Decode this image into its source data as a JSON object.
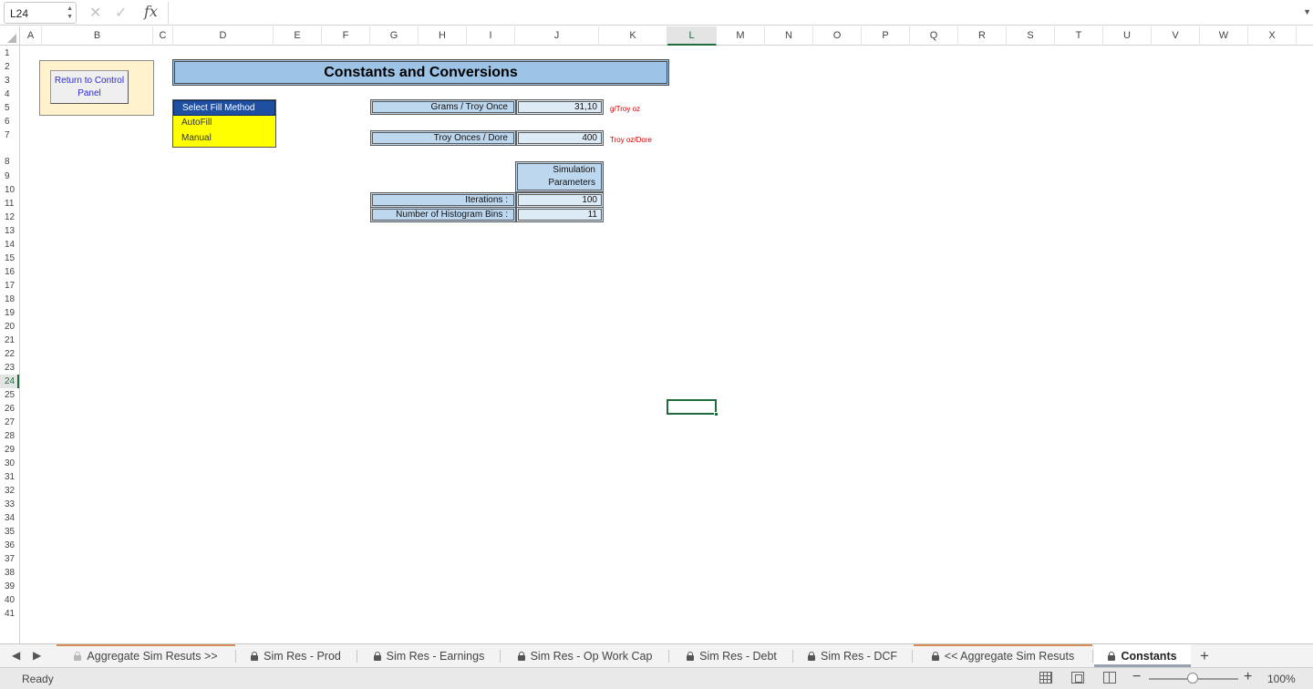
{
  "formula_bar": {
    "name_box": "L24",
    "cancel_icon": "✕",
    "enter_icon": "✓",
    "fx_label": "fx",
    "formula": ""
  },
  "columns": [
    {
      "label": "A",
      "selected": false
    },
    {
      "label": "B",
      "selected": false
    },
    {
      "label": "C",
      "selected": false
    },
    {
      "label": "D",
      "selected": false
    },
    {
      "label": "E",
      "selected": false
    },
    {
      "label": "F",
      "selected": false
    },
    {
      "label": "G",
      "selected": false
    },
    {
      "label": "H",
      "selected": false
    },
    {
      "label": "I",
      "selected": false
    },
    {
      "label": "J",
      "selected": false
    },
    {
      "label": "K",
      "selected": false
    },
    {
      "label": "L",
      "selected": true
    },
    {
      "label": "M",
      "selected": false
    },
    {
      "label": "N",
      "selected": false
    },
    {
      "label": "O",
      "selected": false
    },
    {
      "label": "P",
      "selected": false
    },
    {
      "label": "Q",
      "selected": false
    },
    {
      "label": "R",
      "selected": false
    },
    {
      "label": "S",
      "selected": false
    },
    {
      "label": "T",
      "selected": false
    },
    {
      "label": "U",
      "selected": false
    },
    {
      "label": "V",
      "selected": false
    },
    {
      "label": "W",
      "selected": false
    },
    {
      "label": "X",
      "selected": false
    }
  ],
  "rows": [
    "1",
    "2",
    "3",
    "4",
    "5",
    "6",
    "7",
    "8",
    "9",
    "10",
    "11",
    "12",
    "13",
    "14",
    "15",
    "16",
    "17",
    "18",
    "19",
    "20",
    "21",
    "22",
    "23",
    "24",
    "25",
    "26",
    "27",
    "28",
    "29",
    "30",
    "31",
    "32",
    "33",
    "34",
    "35",
    "36",
    "37",
    "38",
    "39",
    "40",
    "41"
  ],
  "selected_row": "24",
  "sheet": {
    "return_button": "Return to Control Panel",
    "title": "Constants and Conversions",
    "fill_method": {
      "header": "Select Fill Method",
      "options": [
        "AutoFill",
        "Manual"
      ]
    },
    "grams_label": "Grams / Troy Once",
    "grams_value": "31,10",
    "grams_unit": "g/Troy oz",
    "troy_label": "Troy Onces / Dore",
    "troy_value": "400",
    "troy_unit": "Troy oz/Dore",
    "sim_header_line1": "Simulation",
    "sim_header_line2": "Parameters",
    "iterations_label": "Iterations :",
    "iterations_value": "100",
    "bins_label": "Number of Histogram Bins :",
    "bins_value": "11"
  },
  "tabs": [
    {
      "label": "Aggregate Sim Resuts >>",
      "locked": true,
      "faint_lock": true,
      "colored": true,
      "active": false
    },
    {
      "label": "Sim Res - Prod",
      "locked": true,
      "faint_lock": false,
      "colored": false,
      "active": false
    },
    {
      "label": "Sim Res - Earnings",
      "locked": true,
      "faint_lock": false,
      "colored": false,
      "active": false
    },
    {
      "label": "Sim Res - Op Work Cap",
      "locked": true,
      "faint_lock": false,
      "colored": false,
      "active": false
    },
    {
      "label": "Sim Res - Debt",
      "locked": true,
      "faint_lock": false,
      "colored": false,
      "active": false
    },
    {
      "label": "Sim Res - DCF",
      "locked": true,
      "faint_lock": false,
      "colored": false,
      "active": false
    },
    {
      "label": "<< Aggregate Sim Resuts",
      "locked": true,
      "faint_lock": false,
      "colored": true,
      "active": false
    },
    {
      "label": "Constants",
      "locked": true,
      "faint_lock": false,
      "colored": false,
      "active": true
    }
  ],
  "add_sheet": "+",
  "status": {
    "text": "Ready",
    "zoom": "100%",
    "zoom_minus": "−",
    "zoom_plus": "+"
  }
}
